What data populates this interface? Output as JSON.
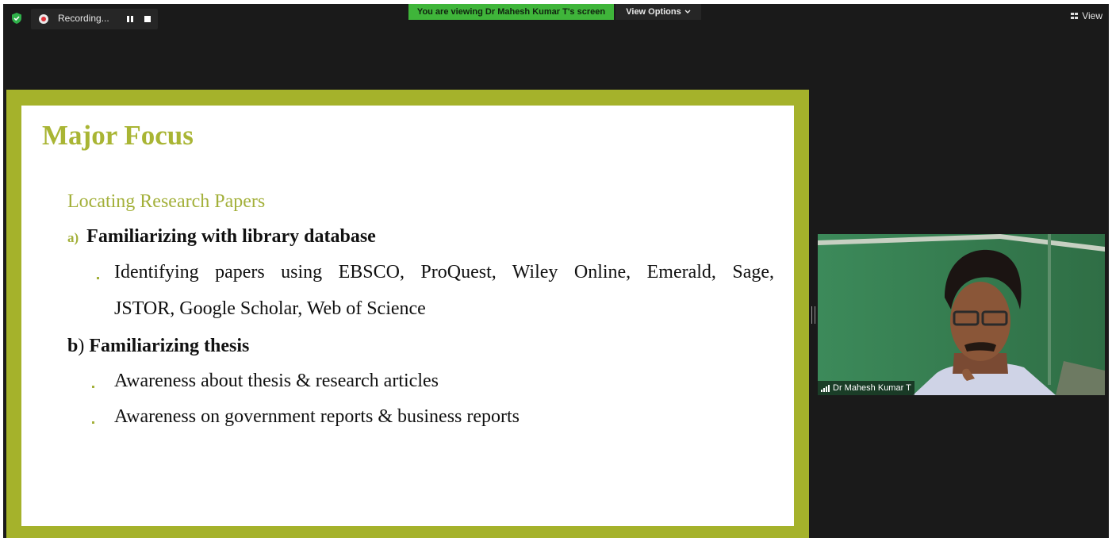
{
  "topbar": {
    "recording_label": "Recording...",
    "viewing_banner": "You are viewing Dr Mahesh Kumar T's screen",
    "view_options_label": "View Options",
    "view_label": "View"
  },
  "slide": {
    "title": "Major Focus",
    "subtitle": "Locating Research Papers",
    "item_a": {
      "marker": "a)",
      "text": "Familiarizing with library database",
      "bullets": [
        "Identifying papers using EBSCO, ProQuest, Wiley Online, Emerald, Sage,",
        "JSTOR, Google Scholar, Web of Science"
      ]
    },
    "item_b": {
      "marker": "b",
      "paren": ")",
      "text": "Familiarizing thesis",
      "bullets": [
        "Awareness about thesis & research articles",
        "Awareness on government reports & business reports"
      ]
    }
  },
  "video": {
    "participant_name": "Dr Mahesh Kumar T"
  },
  "colors": {
    "accent_green": "#a9b534",
    "banner_green": "#3fb53a",
    "app_background": "#1a1a1a"
  },
  "icons": [
    "shield-icon",
    "record-icon",
    "pause-icon",
    "stop-icon",
    "chevron-down-icon",
    "grid-icon",
    "signal-icon"
  ]
}
